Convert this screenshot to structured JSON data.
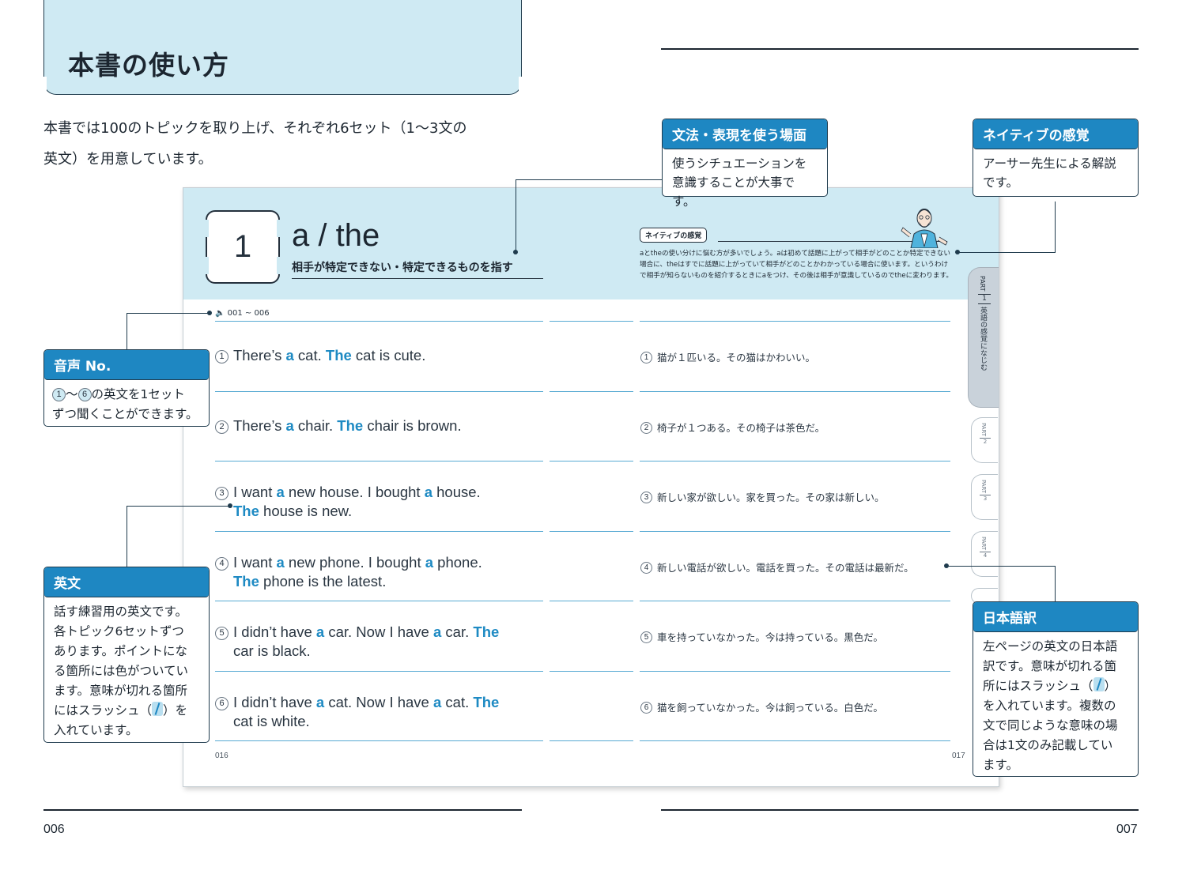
{
  "header": {
    "title": "本書の使い方"
  },
  "intro": {
    "line1": "本書では100のトピックを取り上げ、それぞれ6セット（1〜3文の",
    "line2": "英文）を用意しています。"
  },
  "spread": {
    "number": "1",
    "topic_title": "a / the",
    "topic_subtitle": "相手が特定できない・特定できるものを指す",
    "native_tag": "ネイティブの感覚",
    "native_body": "aとtheの使い分けに悩む方が多いでしょう。aは初めて話題に上がって相手がどのことか特定できない場合に、theはすでに話題に上がっていて相手がどのことかわかっている場合に使います。というわけで相手が知らないものを紹介するときにaをつけ、その後は相手が意識しているのでtheに変わります。",
    "audio_label": "001 ~ 006",
    "tab_part1": {
      "part": "PART",
      "num": "1",
      "label": "英語の感覚になじむ"
    },
    "tabs_small": [
      {
        "part": "PART",
        "num": "2"
      },
      {
        "part": "PART",
        "num": "3"
      },
      {
        "part": "PART",
        "num": "4"
      }
    ],
    "rows": [
      {
        "num": "1",
        "en": [
          [
            "There’s ",
            ""
          ],
          [
            "a",
            "hl"
          ],
          [
            " cat. ",
            ""
          ],
          [
            "The",
            "hl"
          ],
          [
            " cat is cute.",
            ""
          ]
        ],
        "ja": "猫が１匹いる。その猫はかわいい。"
      },
      {
        "num": "2",
        "en": [
          [
            "There’s ",
            ""
          ],
          [
            "a",
            "hl"
          ],
          [
            " chair. ",
            ""
          ],
          [
            "The",
            "hl"
          ],
          [
            " chair is brown.",
            ""
          ]
        ],
        "ja": "椅子が１つある。その椅子は茶色だ。"
      },
      {
        "num": "3",
        "en": [
          [
            "I want ",
            ""
          ],
          [
            "a",
            "hl"
          ],
          [
            " new house. I bought ",
            ""
          ],
          [
            "a",
            "hl"
          ],
          [
            " house.",
            ""
          ],
          [
            "|",
            "br"
          ],
          [
            "The",
            "hl"
          ],
          [
            " house is new.",
            ""
          ]
        ],
        "ja": "新しい家が欲しい。家を買った。その家は新しい。"
      },
      {
        "num": "4",
        "en": [
          [
            "I want ",
            ""
          ],
          [
            "a",
            "hl"
          ],
          [
            " new phone. I bought ",
            ""
          ],
          [
            "a",
            "hl"
          ],
          [
            " phone.",
            ""
          ],
          [
            "|",
            "br"
          ],
          [
            "The",
            "hl"
          ],
          [
            " phone is the latest.",
            ""
          ]
        ],
        "ja": "新しい電話が欲しい。電話を買った。その電話は最新だ。"
      },
      {
        "num": "5",
        "en": [
          [
            "I didn’t have ",
            ""
          ],
          [
            "a",
            "hl"
          ],
          [
            " car. Now I have ",
            ""
          ],
          [
            "a",
            "hl"
          ],
          [
            " car. ",
            ""
          ],
          [
            "The",
            "hl"
          ],
          [
            "|",
            "br"
          ],
          [
            "car is black.",
            ""
          ]
        ],
        "ja": "車を持っていなかった。今は持っている。黒色だ。"
      },
      {
        "num": "6",
        "en": [
          [
            "I didn’t have ",
            ""
          ],
          [
            "a",
            "hl"
          ],
          [
            " cat. Now I have ",
            ""
          ],
          [
            "a",
            "hl"
          ],
          [
            " cat. ",
            ""
          ],
          [
            "The",
            "hl"
          ],
          [
            "|",
            "br"
          ],
          [
            "cat is white.",
            ""
          ]
        ],
        "ja": "猫を飼っていなかった。今は飼っている。白色だ。"
      }
    ],
    "folio_left": "016",
    "folio_right": "017"
  },
  "callouts": {
    "scene": {
      "head": "文法・表現を使う場面",
      "line1": "使うシチュエーションを",
      "line2": "意識することが大事です。"
    },
    "native": {
      "head": "ネイティブの感覚",
      "line1": "アーサー先生による解説",
      "line2": "です。"
    },
    "audio": {
      "head": "音声 No.",
      "c1": "1",
      "mid": "〜",
      "c2": "6",
      "line1_rest": "の英文を1セット",
      "line2": "ずつ聞くことができます。"
    },
    "english": {
      "head": "英文",
      "l1": "話す練習用の英文です。",
      "l2": "各トピック6セットずつ",
      "l3": "あります。ポイントにな",
      "l4": "る箇所には色がついてい",
      "l5": "ます。意味が切れる箇所",
      "l6a": "にはスラッシュ（",
      "l6b": "）を",
      "l7": "入れています。"
    },
    "japanese": {
      "head": "日本語訳",
      "l1": "左ページの英文の日本語",
      "l2": "訳です。意味が切れる箇",
      "l3": "所にはスラッシュ（",
      "l3b": "）",
      "l4": "を入れています。複数の",
      "l5": "文で同じような意味の場",
      "l6": "合は1文のみ記載してい",
      "l7": "ます。"
    }
  },
  "footer": {
    "left": "006",
    "right": "007"
  },
  "colors": {
    "accent_blue": "#1e87c2",
    "header_bg": "#cfeaf3",
    "rule_blue": "#58aad3"
  }
}
